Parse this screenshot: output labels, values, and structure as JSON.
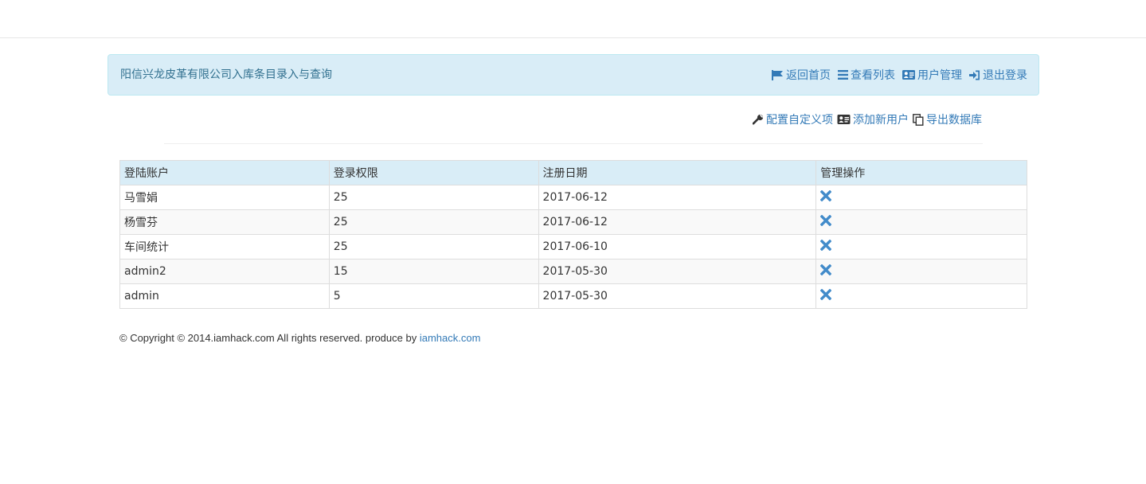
{
  "header": {
    "title": "阳信兴龙皮革有限公司入库条目录入与查询",
    "nav": [
      {
        "label": "返回首页",
        "icon": "flag-icon"
      },
      {
        "label": "查看列表",
        "icon": "list-icon"
      },
      {
        "label": "用户管理",
        "icon": "vcard-icon"
      },
      {
        "label": "退出登录",
        "icon": "log-in-icon"
      }
    ]
  },
  "tools": [
    {
      "label": "配置自定义项",
      "icon": "wrench-icon"
    },
    {
      "label": "添加新用户",
      "icon": "vcard-icon"
    },
    {
      "label": "导出数据库",
      "icon": "copy-icon"
    }
  ],
  "table": {
    "columns": [
      "登陆账户",
      "登录权限",
      "注册日期",
      "管理操作"
    ],
    "rows": [
      {
        "account": "马雪娟",
        "permission": "25",
        "date": "2017-06-12"
      },
      {
        "account": "杨雪芬",
        "permission": "25",
        "date": "2017-06-12"
      },
      {
        "account": "车间统计",
        "permission": "25",
        "date": "2017-06-10"
      },
      {
        "account": "admin2",
        "permission": "15",
        "date": "2017-05-30"
      },
      {
        "account": "admin",
        "permission": "5",
        "date": "2017-05-30"
      }
    ]
  },
  "footer": {
    "text": "© Copyright © 2014.iamhack.com All rights reserved. produce by ",
    "link": "iamhack.com"
  },
  "colors": {
    "panel_bg": "#d9edf7",
    "link": "#337ab7",
    "delete_icon": "#428bca"
  }
}
